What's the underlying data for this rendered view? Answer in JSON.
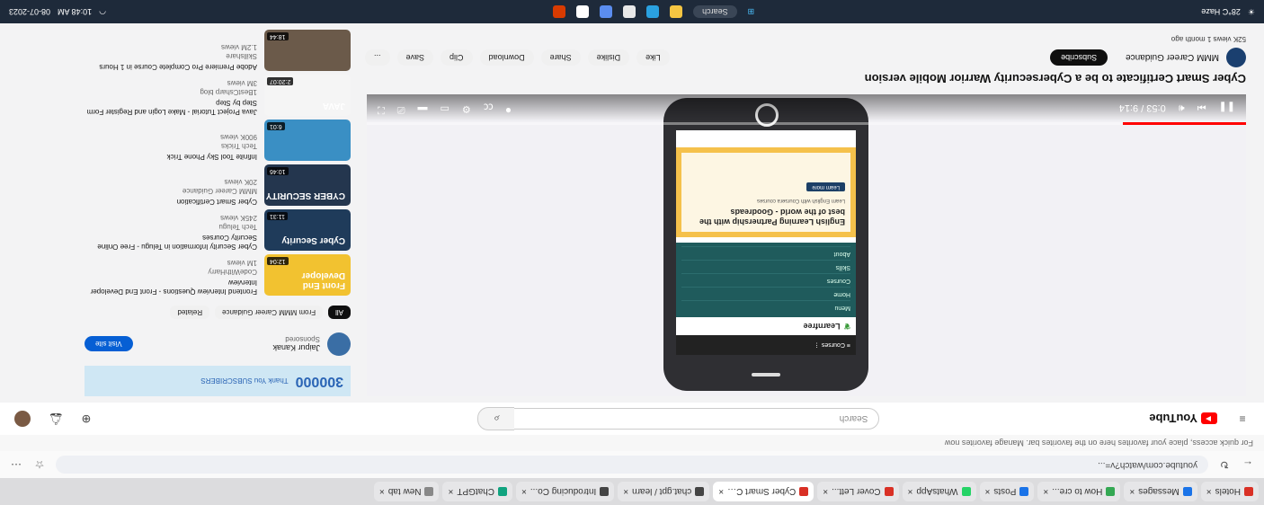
{
  "browser": {
    "tabs": [
      {
        "label": "Hotels",
        "color": "#d93025"
      },
      {
        "label": "Messages",
        "color": "#1a73e8"
      },
      {
        "label": "How to cre...",
        "color": "#34a853"
      },
      {
        "label": "Posts",
        "color": "#1a73e8"
      },
      {
        "label": "WhatsApp",
        "color": "#25d366"
      },
      {
        "label": "Cover Lett...",
        "color": "#d93025"
      },
      {
        "label": "Cyber Smart Ce...",
        "color": "#d93025",
        "active": true
      },
      {
        "label": "chat.gpt / learn",
        "color": "#444444"
      },
      {
        "label": "Introducing Co...",
        "color": "#444444"
      },
      {
        "label": "ChatGPT",
        "color": "#10a37f"
      },
      {
        "label": "New tab",
        "color": "#888888"
      }
    ],
    "url": "youtube.com/watch?v=...",
    "bookmarks_text": "For quick access, place your favorites here on the favorites bar. Manage favorites now"
  },
  "youtube": {
    "logo_text": "YouTube",
    "search_placeholder": "Search",
    "icons": [
      "create-icon",
      "bell-icon",
      "avatar"
    ]
  },
  "video": {
    "title": "Cyber Smart Certificate to be a Cybersecurity Warrior Mobile version",
    "channel": "MMM Career Guidance",
    "subscribe_label": "Subscribe",
    "actions": [
      "Like",
      "Dislike",
      "Share",
      "Download",
      "Clip",
      "Save",
      "..."
    ],
    "meta": "52K views  1 month ago",
    "progress": 0.14,
    "time": "0:53 / 9:14"
  },
  "phone_screen": {
    "nav": "≡  Courses  ⋮",
    "brand": "Learnfree",
    "menu": [
      "Menu",
      "Home",
      "Courses",
      "Skills",
      "About"
    ],
    "banner_title": "English Learning Partnership with the best of the world - Goodreads",
    "banner_sub": "Learn English with Coursera courses",
    "banner_btn": "Learn more"
  },
  "sidebar": {
    "ad_banner": {
      "title": "300000",
      "sub": "Thank You SUBSCRIBERS"
    },
    "sponsor": {
      "name": "Jaipur Kanak",
      "tag": "Sponsored",
      "button": "Visit site"
    },
    "chips": [
      "All",
      "From MMM Career Guidance",
      "Related"
    ],
    "recommendations": [
      {
        "thumb": "Front End Developer",
        "color": "#f2c230",
        "dur": "12:04",
        "title": "Frontend Interview Questions - Front End Developer Interview",
        "channel": "CodeWithHarry",
        "meta": "1M views"
      },
      {
        "thumb": "Cyber Security",
        "color": "#1f3b5a",
        "dur": "11:31",
        "title": "Cyber Security Information in Telugu - Free Online Security Courses",
        "channel": "Tech Telugu",
        "meta": "245K views"
      },
      {
        "thumb": "CYBER SECURITY",
        "color": "#24364e",
        "dur": "10:46",
        "title": "Cyber Smart Certification",
        "channel": "MMM Career Guidance",
        "meta": "20K views"
      },
      {
        "thumb": "",
        "color": "#3a8fc4",
        "dur": "6:01",
        "title": "Infinite Tool Sky Phone Trick",
        "channel": "Tech Tricks",
        "meta": "900K views"
      },
      {
        "thumb": "JAVA",
        "color": "#f5f5f5",
        "dur": "2:20:07",
        "title": "Java Project Tutorial - Make Login and Register Form Step by Step",
        "channel": "1BestCsharp blog",
        "meta": "3M views"
      },
      {
        "thumb": "",
        "color": "#6b5a4a",
        "dur": "18:44",
        "title": "Adobe Premiere Pro Complete Course in 1 Hours",
        "channel": "Skillshare",
        "meta": "1.2M views"
      }
    ]
  },
  "taskbar": {
    "search": "Search",
    "weather": "28°C Haze",
    "time": "10:48 AM",
    "date": "08-07-2023"
  }
}
